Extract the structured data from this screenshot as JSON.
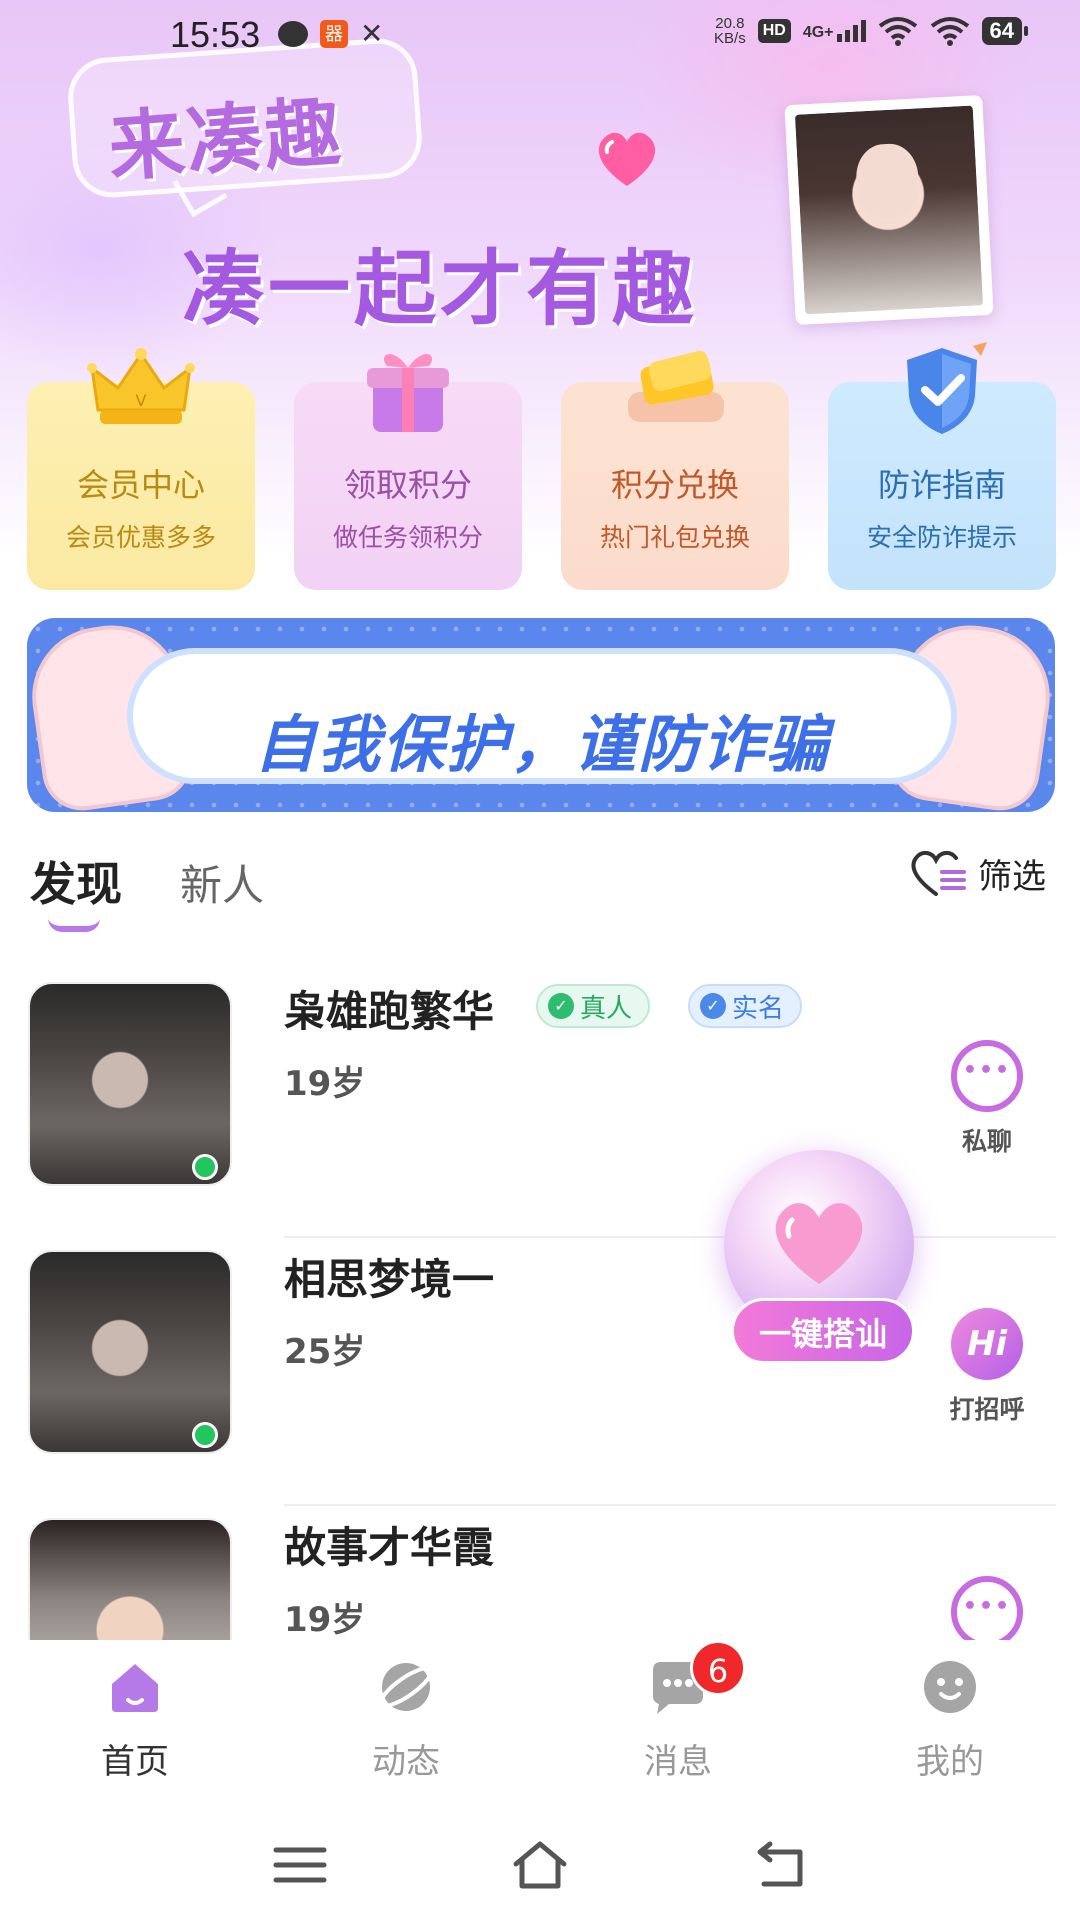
{
  "status_bar": {
    "time": "15:53",
    "speed_value": "20.8",
    "speed_unit": "KB/s",
    "hd": "HD",
    "network": "4G+",
    "battery": "64"
  },
  "hero": {
    "title": "来凑趣",
    "subtitle": "凑一起才有趣"
  },
  "features": [
    {
      "title": "会员中心",
      "subtitle": "会员优惠多多",
      "icon": "crown-icon"
    },
    {
      "title": "领取积分",
      "subtitle": "做任务领积分",
      "icon": "gift-icon"
    },
    {
      "title": "积分兑换",
      "subtitle": "热门礼包兑换",
      "icon": "coupon-icon"
    },
    {
      "title": "防诈指南",
      "subtitle": "安全防诈提示",
      "icon": "shield-icon"
    }
  ],
  "banner": {
    "text": "自我保护，谨防诈骗"
  },
  "tabs": {
    "discover": "发现",
    "new": "新人",
    "filter": "筛选"
  },
  "users": [
    {
      "name": "枭雄跑繁华",
      "age": "19岁",
      "badge_real": "真人",
      "badge_verified": "实名",
      "action": "私聊",
      "online": true
    },
    {
      "name": "相思梦境一",
      "age": "25岁",
      "action": "打招呼",
      "action_icon_text": "Hi",
      "online": true
    },
    {
      "name": "故事才华霞",
      "age": "19岁",
      "online": false
    }
  ],
  "floating": {
    "button": "一键搭讪"
  },
  "bottom_nav": {
    "home": "首页",
    "moments": "动态",
    "messages": "消息",
    "messages_badge": "6",
    "mine": "我的",
    "accent_color": "#b57ae8"
  }
}
